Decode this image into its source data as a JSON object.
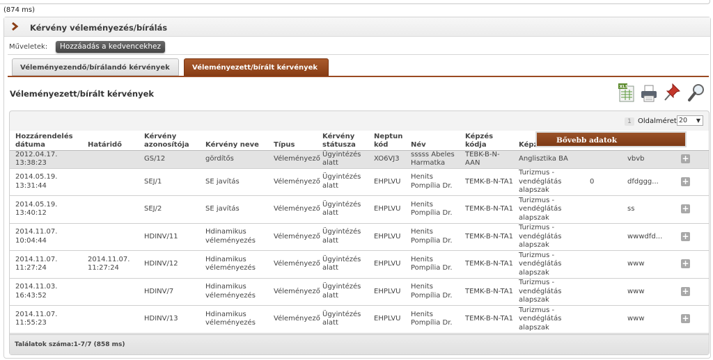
{
  "timing": "(874 ms)",
  "panel": {
    "title": "Kérvény véleményezés/bírálás"
  },
  "operations": {
    "label": "Műveletek:",
    "add_favorite": "Hozzáadás a kedvencekhez"
  },
  "tabs": [
    {
      "label": "Véleményezendő/bírálandó kérvények",
      "active": false
    },
    {
      "label": "Véleményezett/bírált kérvények",
      "active": true
    }
  ],
  "section": {
    "title": "Véleményezett/bírált kérvények"
  },
  "toolbar_icons": [
    "excel-export-icon",
    "print-icon",
    "pin-icon",
    "search-icon"
  ],
  "paging": {
    "current_page": "1",
    "page_size_label": "Oldalméret",
    "page_size": "20"
  },
  "table": {
    "headers": [
      "Hozzárendelés dátuma",
      "Határidő",
      "Kérvény azonosítója",
      "Kérvény neve",
      "Típus",
      "Kérvény státusza",
      "Neptun kód",
      "Név",
      "Képzés kódja",
      "Képz",
      "",
      "",
      ""
    ],
    "rows": [
      [
        "2012.04.17. 13:38:23",
        "",
        "GS/12",
        "gördítős",
        "Véleményező",
        "Ügyintézés alatt",
        "XO6VJ3",
        "sssss Abeles Harmatka",
        "TEBK-B-N-AAN",
        "Anglisztika BA",
        "",
        "vbvb",
        "+"
      ],
      [
        "2014.05.19. 13:31:44",
        "",
        "SEJ/1",
        "SE javítás",
        "Véleményező",
        "Ügyintézés alatt",
        "EHPLVU",
        "Henits Pompília Dr.",
        "TEMK-B-N-TA1",
        "Turizmus - vendéglátás alapszak",
        "0",
        "dfdggg...",
        "+"
      ],
      [
        "2014.05.19. 13:40:12",
        "",
        "SEJ/2",
        "SE javítás",
        "Véleményező",
        "Ügyintézés alatt",
        "EHPLVU",
        "Henits Pompília Dr.",
        "TEMK-B-N-TA1",
        "Turizmus - vendéglátás alapszak",
        "",
        "ss",
        "+"
      ],
      [
        "2014.11.07. 10:04:44",
        "",
        "HDINV/11",
        "Hdinamikus véleményezés",
        "Véleményező",
        "Ügyintézés alatt",
        "EHPLVU",
        "Henits Pompília Dr.",
        "TEMK-B-N-TA1",
        "Turizmus - vendéglátás alapszak",
        "",
        "wwwdfd...",
        "+"
      ],
      [
        "2014.11.07. 11:27:24",
        "2014.11.07. 11:27:24",
        "HDINV/12",
        "Hdinamikus véleményezés",
        "Véleményező",
        "Ügyintézés alatt",
        "EHPLVU",
        "Henits Pompília Dr.",
        "TEMK-B-N-TA1",
        "Turizmus - vendéglátás alapszak",
        "",
        "www",
        "+"
      ],
      [
        "2014.11.03. 16:43:52",
        "",
        "HDINV/7",
        "Hdinamikus véleményezés",
        "Véleményező",
        "Ügyintézés alatt",
        "EHPLVU",
        "Henits Pompília Dr.",
        "TEMK-B-N-TA1",
        "Turizmus - vendéglátás alapszak",
        "",
        "www",
        "+"
      ],
      [
        "2014.11.07. 11:55:23",
        "",
        "HDINV/13",
        "Hdinamikus véleményezés",
        "Véleményező",
        "Ügyintézés alatt",
        "EHPLVU",
        "Henits Pompília Dr.",
        "TEMK-B-N-TA1",
        "Turizmus - vendéglátás alapszak",
        "",
        "www",
        "+"
      ]
    ]
  },
  "context_tooltip": "Bővebb adatok",
  "footer": {
    "results": "Találatok száma:1-7/7 (858 ms)"
  },
  "colors": {
    "accent": "#9a4a22",
    "tab_active": "#8a3e16"
  }
}
